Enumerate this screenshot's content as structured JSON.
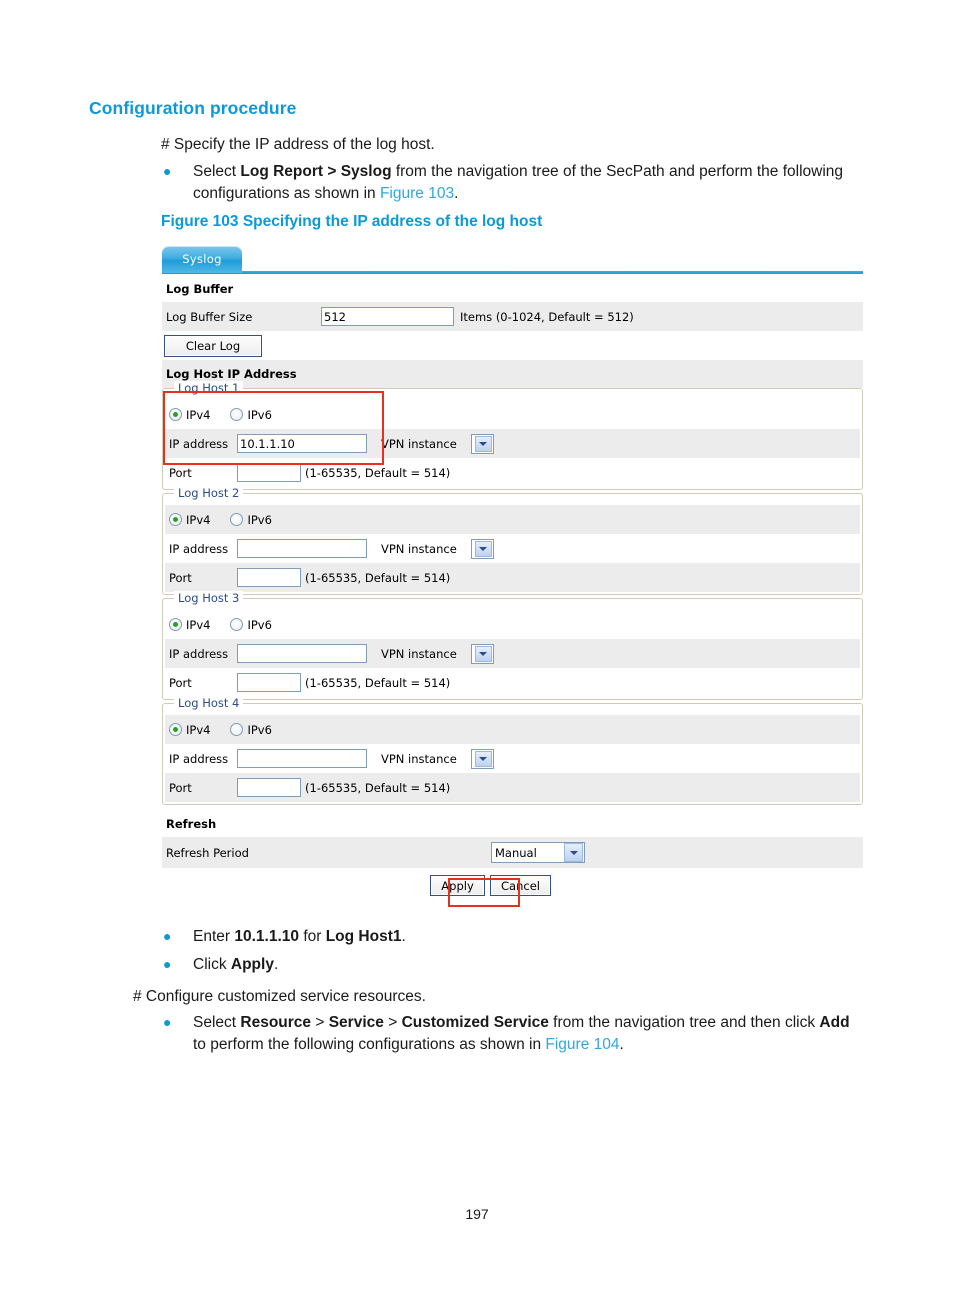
{
  "document": {
    "heading": "Configuration procedure",
    "intro_line": "# Specify the IP address of the log host.",
    "bullet1": {
      "dot": "●",
      "pre": "Select ",
      "bold1": "Log Report > Syslog",
      "mid": " from the navigation tree of the SecPath and perform the following configurations as shown in ",
      "link": "Figure 103",
      "post": "."
    },
    "figure_caption": "Figure 103 Specifying the IP address of the log host",
    "bullet2": {
      "dot": "●",
      "pre": "Enter ",
      "bold1": "10.1.1.10",
      "mid": " for ",
      "bold2": "Log Host1",
      "post": "."
    },
    "bullet3": {
      "dot": "●",
      "pre": "Click ",
      "bold1": "Apply",
      "post": "."
    },
    "second_intro_line": "# Configure customized service resources.",
    "bullet4": {
      "dot": "●",
      "pre": "Select ",
      "bold1": "Resource",
      "sep1": " > ",
      "bold2": "Service",
      "sep2": " > ",
      "bold3": "Customized Service",
      "mid": " from the navigation tree and then click ",
      "bold4": "Add",
      "post1": " to perform the following configurations as shown in ",
      "link": "Figure 104",
      "post2": "."
    },
    "page_number": "197"
  },
  "screenshot": {
    "tab": {
      "label": "Syslog"
    },
    "log_buffer": {
      "section_title": "Log Buffer",
      "size_label": "Log Buffer Size",
      "size_value": "512",
      "size_hint": "Items (0-1024, Default = 512)",
      "clear_button": "Clear Log"
    },
    "log_host_section_title": "Log Host IP Address",
    "common": {
      "ipv4_label": "IPv4",
      "ipv6_label": "IPv6",
      "ip_label": "IP address",
      "vpn_label": "VPN instance",
      "port_label": "Port",
      "port_hint": "(1-65535, Default = 514)"
    },
    "hosts": [
      {
        "legend": "Log Host 1",
        "ipv4_selected": true,
        "ip_value": "10.1.1.10",
        "port_value": "",
        "vpn_value": ""
      },
      {
        "legend": "Log Host 2",
        "ipv4_selected": true,
        "ip_value": "",
        "port_value": "",
        "vpn_value": ""
      },
      {
        "legend": "Log Host 3",
        "ipv4_selected": true,
        "ip_value": "",
        "port_value": "",
        "vpn_value": ""
      },
      {
        "legend": "Log Host 4",
        "ipv4_selected": true,
        "ip_value": "",
        "port_value": "",
        "vpn_value": ""
      }
    ],
    "refresh": {
      "section_title": "Refresh",
      "period_label": "Refresh Period",
      "period_value": "Manual"
    },
    "actions": {
      "apply": "Apply",
      "cancel": "Cancel"
    }
  },
  "colors": {
    "heading_blue": "#0b9ad6",
    "link_blue": "#2fa8dd",
    "annotation_red": "#e8301c",
    "tab_blue": "#1f9cd8",
    "row_gray": "#ececec",
    "legend_blue": "#2a4b8d",
    "radio_green": "#1fa61f"
  }
}
